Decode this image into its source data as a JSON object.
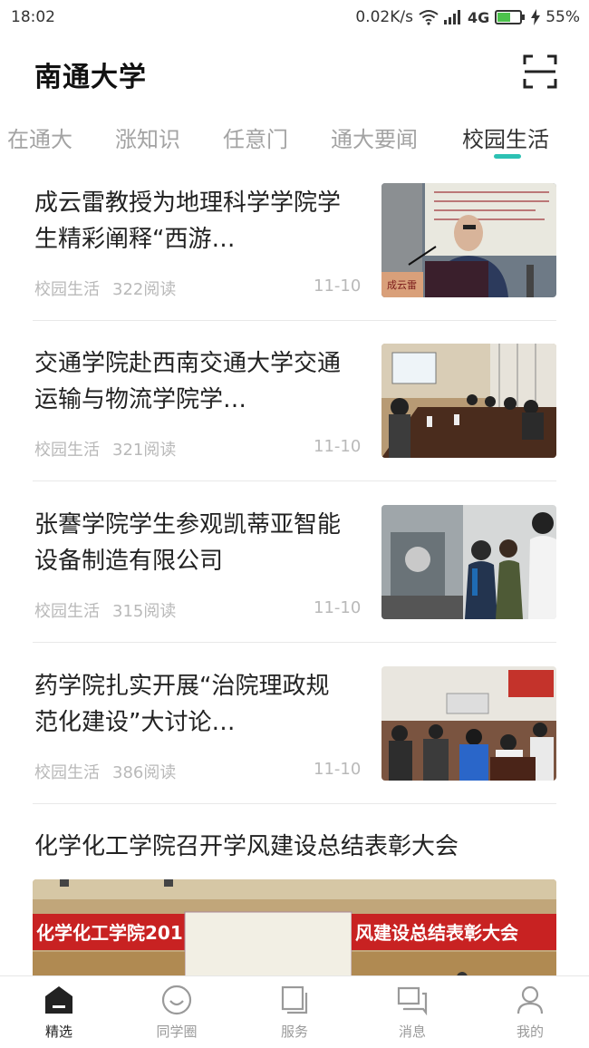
{
  "status_bar": {
    "time": "18:02",
    "network_speed": "0.02K/s",
    "network_type": "4G",
    "battery": "55%",
    "icons": [
      "wifi-icon",
      "signal-icon",
      "battery-icon",
      "charging-icon"
    ]
  },
  "header": {
    "title": "南通大学",
    "scan_icon": "scan-icon"
  },
  "tabs": [
    {
      "label": "在通大"
    },
    {
      "label": "涨知识"
    },
    {
      "label": "任意门"
    },
    {
      "label": "通大要闻"
    },
    {
      "label": "校园生活",
      "active": true
    }
  ],
  "articles": [
    {
      "title": "成云雷教授为地理科学学院学生精彩阐释“西游…",
      "category": "校园生活",
      "reads": "322阅读",
      "date": "11-10",
      "image_caption": "成云雷"
    },
    {
      "title": "交通学院赴西南交通大学交通运输与物流学院学…",
      "category": "校园生活",
      "reads": "321阅读",
      "date": "11-10"
    },
    {
      "title": "张謇学院学生参观凯蒂亚智能设备制造有限公司",
      "category": "校园生活",
      "reads": "315阅读",
      "date": "11-10"
    },
    {
      "title": "药学院扎实开展“治院理政规范化建设”大讨论…",
      "category": "校园生活",
      "reads": "386阅读",
      "date": "11-10"
    }
  ],
  "featured_article": {
    "title": "化学化工学院召开学风建设总结表彰大会",
    "banner_left": "化学化工学院201",
    "banner_right": "风建设总结表彰大会"
  },
  "bottom_nav": [
    {
      "label": "精选",
      "icon": "home-icon",
      "active": true
    },
    {
      "label": "同学圈",
      "icon": "smile-icon"
    },
    {
      "label": "服务",
      "icon": "service-icon"
    },
    {
      "label": "消息",
      "icon": "message-icon"
    },
    {
      "label": "我的",
      "icon": "profile-icon"
    }
  ],
  "colors": {
    "accent": "#2cc1b3",
    "text_primary": "#222222",
    "text_secondary": "#b9b9b9",
    "tab_inactive": "#a3a3a3"
  }
}
